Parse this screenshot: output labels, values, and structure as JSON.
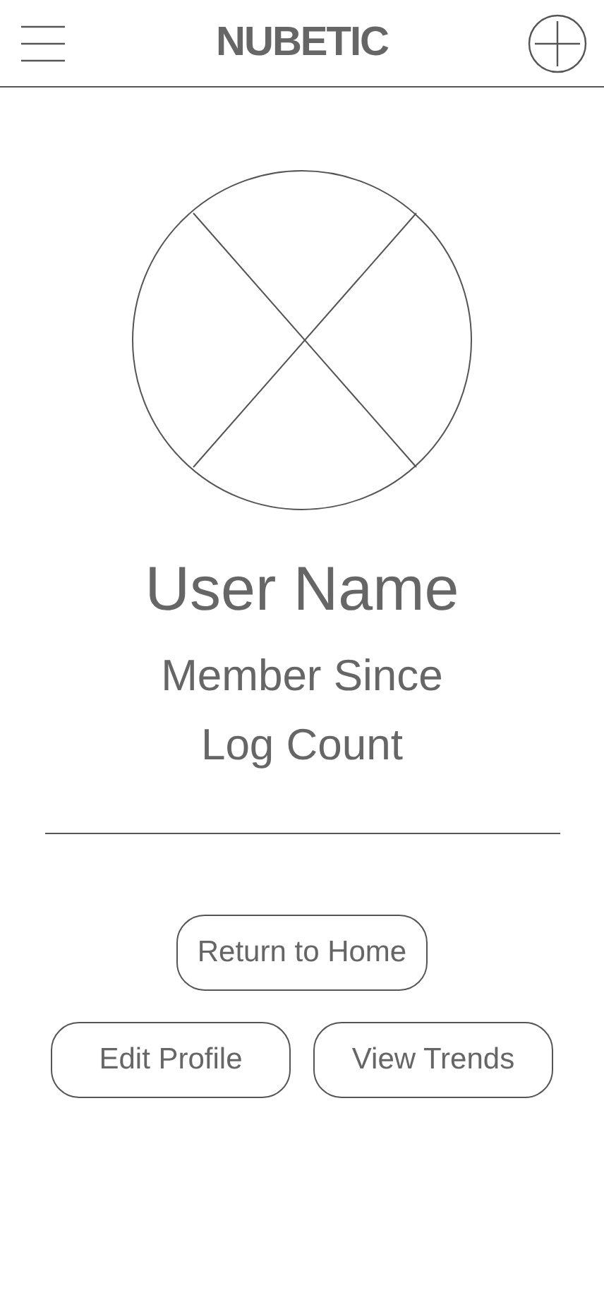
{
  "header": {
    "title": "NUBETIC"
  },
  "profile": {
    "name": "User Name",
    "details": [
      "Member Since",
      "Log Count"
    ]
  },
  "buttons": [
    {
      "label": "Return to Home"
    },
    {
      "label": "Edit Profile"
    },
    {
      "label": "View Trends"
    }
  ]
}
